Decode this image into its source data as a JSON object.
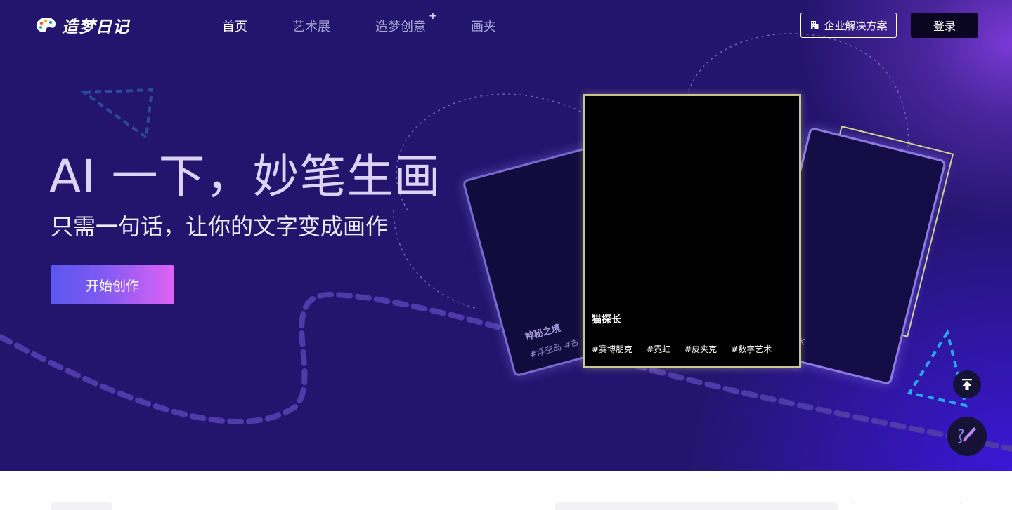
{
  "header": {
    "logo_text": "造梦日记",
    "nav": [
      {
        "label": "首页",
        "active": true
      },
      {
        "label": "艺术展",
        "active": false
      },
      {
        "label": "造梦创意",
        "active": false,
        "badge": "+"
      },
      {
        "label": "画夹",
        "active": false
      }
    ],
    "enterprise_label": "企业解决方案",
    "login_label": "登录"
  },
  "hero": {
    "title": "AI 一下，妙笔生画",
    "subtitle": "只需一句话，让你的文字变成画作",
    "cta_label": "开始创作"
  },
  "cards": {
    "left": {
      "title": "神秘之境",
      "tags": "#浮空岛  #古"
    },
    "main": {
      "title": "猫探长",
      "tags": [
        "#赛博朋克",
        "#霓虹",
        "#皮夹克",
        "#数字艺术"
      ]
    },
    "right": {
      "tag": "#4K"
    }
  },
  "float_buttons": {
    "top": "arrow-up-to-line-icon",
    "create": "paint-brush-icon"
  },
  "colors": {
    "hero_bg": "#23156e",
    "accent_glow": "#3b17d8",
    "cta_gradient_start": "#5b57ef",
    "cta_gradient_end": "#e062f5",
    "login_bg": "#0a0520",
    "card_frame": "#c9c58b"
  }
}
